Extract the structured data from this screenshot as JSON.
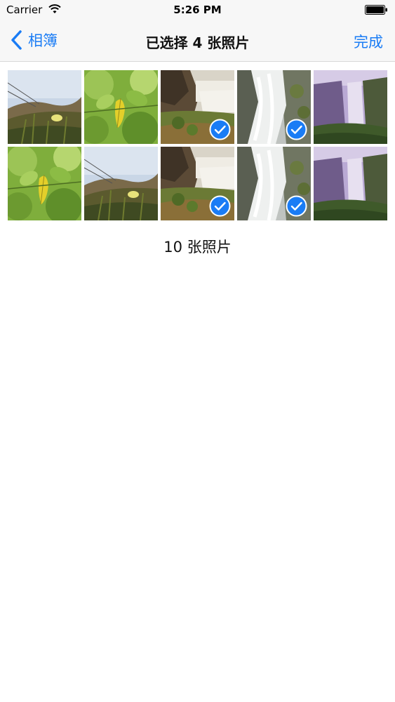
{
  "status_bar": {
    "carrier": "Carrier",
    "time": "5:26 PM",
    "wifi_icon": "wifi-icon",
    "battery_icon": "battery-icon"
  },
  "nav": {
    "back_label": "相簿",
    "title": "已选择 4 张照片",
    "done_label": "完成",
    "accent": "#1a7cf5"
  },
  "photos": [
    {
      "scene": "grass-hill",
      "selected": false
    },
    {
      "scene": "leaf",
      "selected": false
    },
    {
      "scene": "waterfall-cliff",
      "selected": true
    },
    {
      "scene": "waterfall-white",
      "selected": true
    },
    {
      "scene": "waterfall-purple",
      "selected": false
    },
    {
      "scene": "leaf",
      "selected": false
    },
    {
      "scene": "grass-hill",
      "selected": false
    },
    {
      "scene": "waterfall-cliff",
      "selected": true
    },
    {
      "scene": "waterfall-white",
      "selected": true
    },
    {
      "scene": "waterfall-purple",
      "selected": false
    }
  ],
  "footer": {
    "count_label": "10 张照片"
  }
}
